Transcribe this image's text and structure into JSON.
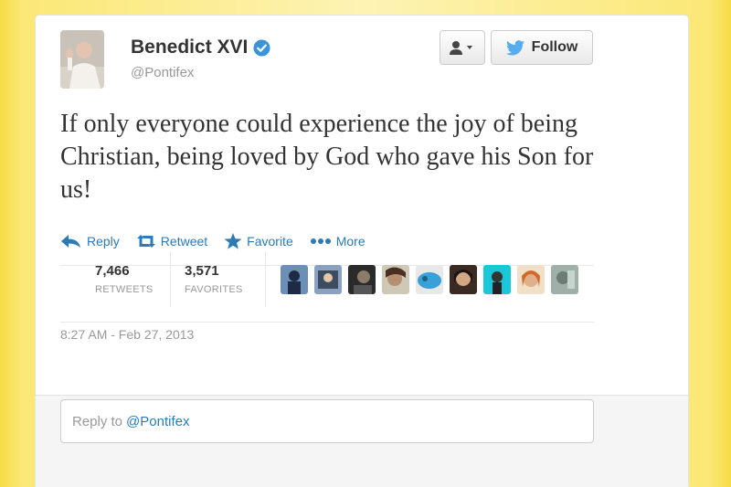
{
  "user": {
    "display_name": "Benedict XVI",
    "handle": "@Pontifex",
    "verified_icon": "verified-badge-icon"
  },
  "header": {
    "user_menu_icon": "user-dropdown-icon",
    "follow_label": "Follow"
  },
  "tweet": {
    "text": "If only everyone could experience the joy of being Christian, being loved by God who gave his Son for us!"
  },
  "actions": {
    "reply": "Reply",
    "retweet": "Retweet",
    "favorite": "Favorite",
    "more": "More"
  },
  "stats": {
    "retweets_count": "7,466",
    "retweets_label": "RETWEETS",
    "favorites_count": "3,571",
    "favorites_label": "FAVORITES"
  },
  "timestamp": "8:27 AM - Feb 27, 2013",
  "reply_box": {
    "prefix": "Reply to",
    "mention": "@Pontifex"
  },
  "colors": {
    "link_blue": "#2b7bb9",
    "verified_blue": "#3b94d9",
    "twitter_bird": "#55acee",
    "background_yellow": "#f7dc45"
  }
}
